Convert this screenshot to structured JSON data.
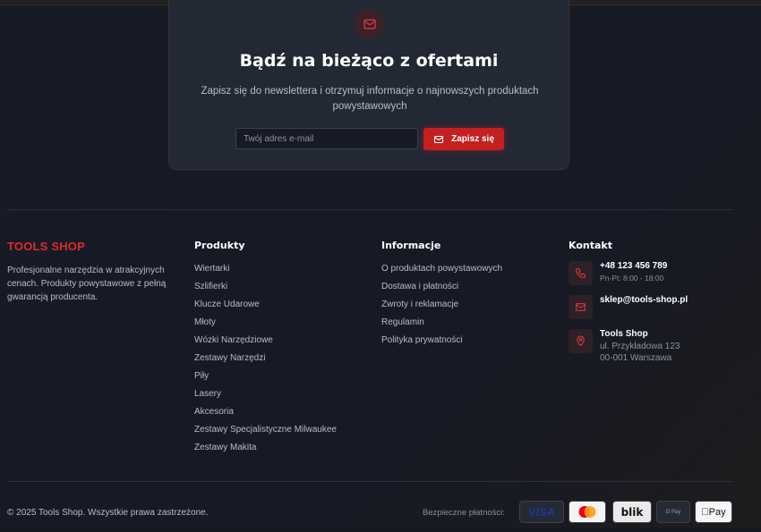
{
  "newsletter": {
    "title": "Bądź na bieżąco z ofertami",
    "subtitle": "Zapisz się do newslettera i otrzymuj informacje o najnowszych produktach powystawowych",
    "email_placeholder": "Twój adres e-mail",
    "button_label": "Zapisz się",
    "icon": "mail-icon"
  },
  "brand": {
    "name": "TOOLS SHOP",
    "description": "Profesjonalne narzędzia w atrakcyjnych cenach. Produkty powystawowe z pełną gwarancją producenta."
  },
  "products": {
    "heading": "Produkty",
    "items": [
      "Wiertarki",
      "Szlifierki",
      "Klucze Udarowe",
      "Młoty",
      "Wózki Narzędziowe",
      "Zestawy Narzędzi",
      "Piły",
      "Lasery",
      "Akcesoria",
      "Zestawy Specjalistyczne Milwaukee",
      "Zestawy Makita"
    ]
  },
  "info": {
    "heading": "Informacje",
    "items": [
      "O produktach powystawowych",
      "Dostawa i płatności",
      "Zwroty i reklamacje",
      "Regulamin",
      "Polityka prywatności"
    ]
  },
  "contact": {
    "heading": "Kontakt",
    "phone": "+48 123 456 789",
    "hours": "Pn-Pt: 8:00 - 18:00",
    "email": "sklep@tools-shop.pl",
    "company": "Tools Shop",
    "street": "ul. Przykładowa 123",
    "city": "00-001 Warszawa"
  },
  "footer": {
    "copyright": "© 2025 Tools Shop. Wszystkie prawa zastrzeżone.",
    "payments_label": "Bezpieczne płatności:",
    "payments": [
      "VISA",
      "Mastercard",
      "blik",
      "G Pay",
      "Apple Pay"
    ]
  },
  "colors": {
    "accent": "#c3201f",
    "brand": "#e02a2a",
    "background": "#161b26"
  }
}
